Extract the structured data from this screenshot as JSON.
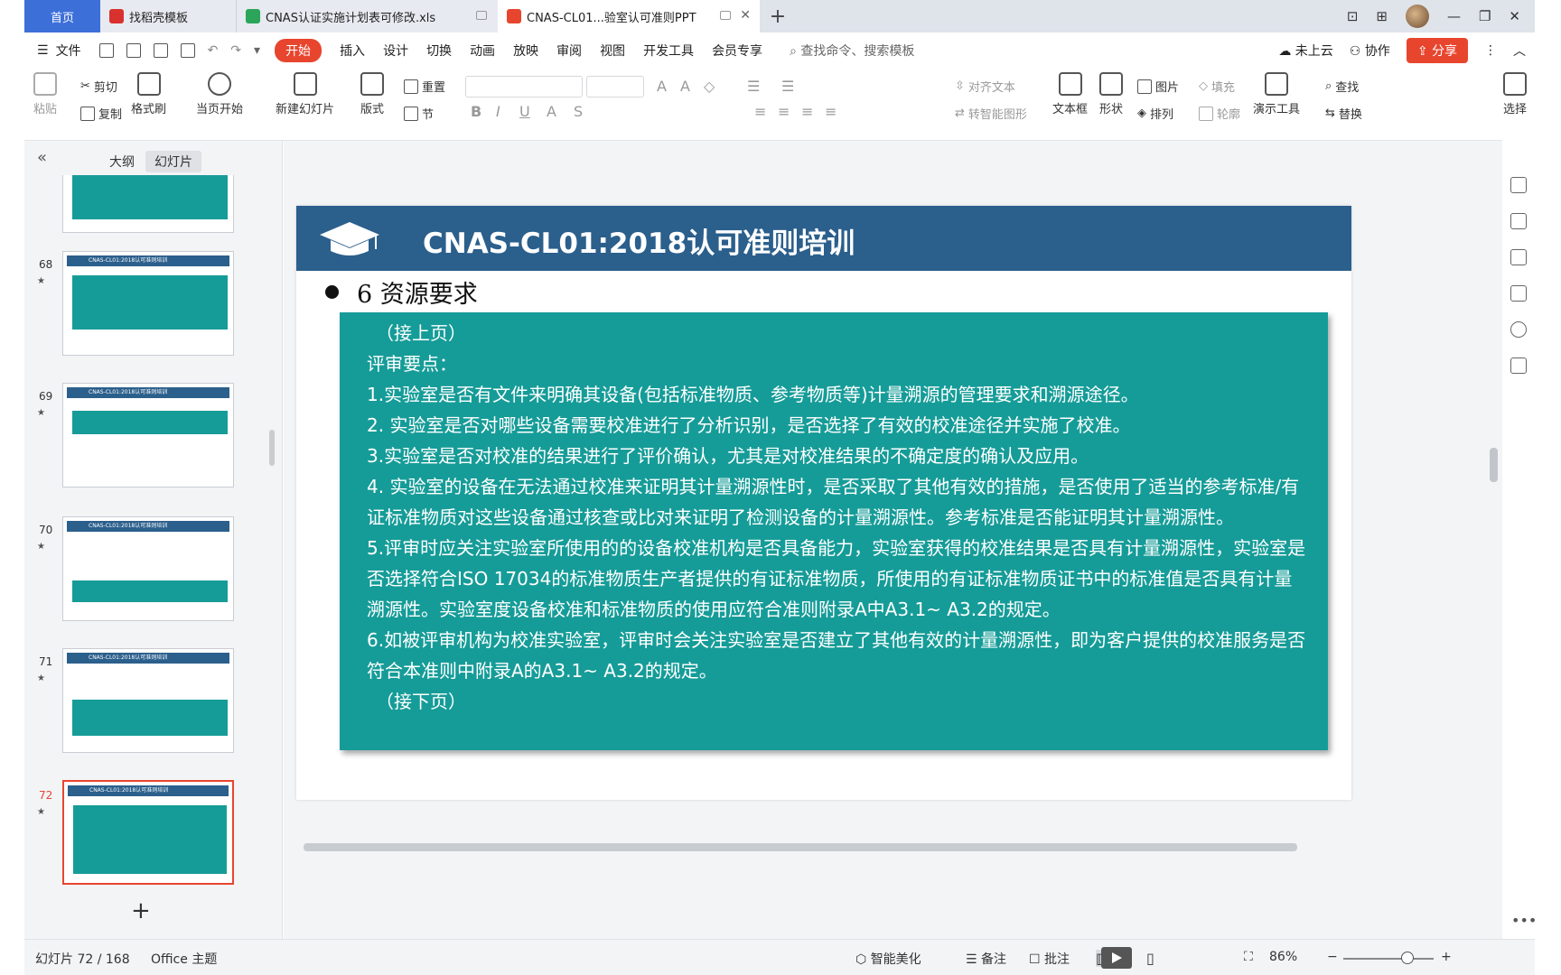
{
  "tabs": [
    {
      "label": "首页",
      "color": "#3d6fd8"
    },
    {
      "label": "找稻壳模板",
      "icon": "docer-icon",
      "color": "#d9312d"
    },
    {
      "label": "CNAS认证实施计划表可修改.xls",
      "icon": "spreadsheet-icon",
      "color": "#2aa55a"
    },
    {
      "label": "CNAS-CL01...验室认可准则PPT",
      "icon": "presentation-icon",
      "color": "#e8452f"
    }
  ],
  "menu": {
    "file": "文件",
    "items": [
      "开始",
      "插入",
      "设计",
      "切换",
      "动画",
      "放映",
      "审阅",
      "视图",
      "开发工具",
      "会员专享"
    ],
    "search_placeholder": "查找命令、搜索模板",
    "cloud": "未上云",
    "collab": "协作",
    "share": "分享"
  },
  "ribbon": {
    "paste": "粘贴",
    "cut": "剪切",
    "copy": "复制",
    "format_painter": "格式刷",
    "from_current": "当页开始",
    "new_slide": "新建幻灯片",
    "layout": "版式",
    "section": "节",
    "reset": "重置",
    "align_text": "对齐文本",
    "smart_shape": "转智能图形",
    "textbox": "文本框",
    "shape": "形状",
    "picture": "图片",
    "fill": "填充",
    "arrange": "排列",
    "outline": "轮廓",
    "present_tools": "演示工具",
    "find": "查找",
    "replace": "替换",
    "select": "选择"
  },
  "panel": {
    "tab_outline": "大纲",
    "tab_slides": "幻灯片",
    "thumbs": [
      {
        "num": "",
        "title": ""
      },
      {
        "num": "68",
        "title": "CNAS-CL01:2018认可准则培训"
      },
      {
        "num": "69",
        "title": "CNAS-CL01:2018认可准则培训"
      },
      {
        "num": "70",
        "title": "CNAS-CL01:2018认可准则培训"
      },
      {
        "num": "71",
        "title": "CNAS-CL01:2018认可准则培训"
      },
      {
        "num": "72",
        "title": "CNAS-CL01:2018认可准则培训"
      }
    ]
  },
  "slide": {
    "title": "CNAS-CL01:2018认可准则培训",
    "section": "6 资源要求",
    "lines": [
      "（接上页）",
      "评审要点：",
      "1.实验室是否有文件来明确其设备(包括标准物质、参考物质等)计量溯源的管理要求和溯源途径。",
      "2. 实验室是否对哪些设备需要校准进行了分析识别，是否选择了有效的校准途径并实施了校准。",
      "3.实验室是否对校准的结果进行了评价确认，尤其是对校准结果的不确定度的确认及应用。",
      "4. 实验室的设备在无法通过校准来证明其计量溯源性时，是否采取了其他有效的措施，是否使用了适当的参考标准/有证标准物质对这些设备通过核查或比对来证明了检测设备的计量溯源性。参考标准是否能证明其计量溯源性。",
      "5.评审时应关注实验室所使用的的设备校准机构是否具备能力，实验室获得的校准结果是否具有计量溯源性，实验室是否选择符合ISO 17034的标准物质生产者提供的有证标准物质，所使用的有证标准物质证书中的标准值是否具有计量溯源性。实验室度设备校准和标准物质的使用应符合准则附录A中A3.1~ A3.2的规定。",
      "6.如被评审机构为校准实验室，评审时会关注实验室是否建立了其他有效的计量溯源性，即为客户提供的校准服务是否符合本准则中附录A的A3.1~ A3.2的规定。",
      "（接下页）"
    ],
    "header_color": "#2b5f8c",
    "box_color": "#169c98"
  },
  "status": {
    "slide_count": "幻灯片 72 / 168",
    "theme": "Office 主题",
    "beautify": "智能美化",
    "notes": "备注",
    "comments": "批注",
    "zoom": "86%"
  }
}
